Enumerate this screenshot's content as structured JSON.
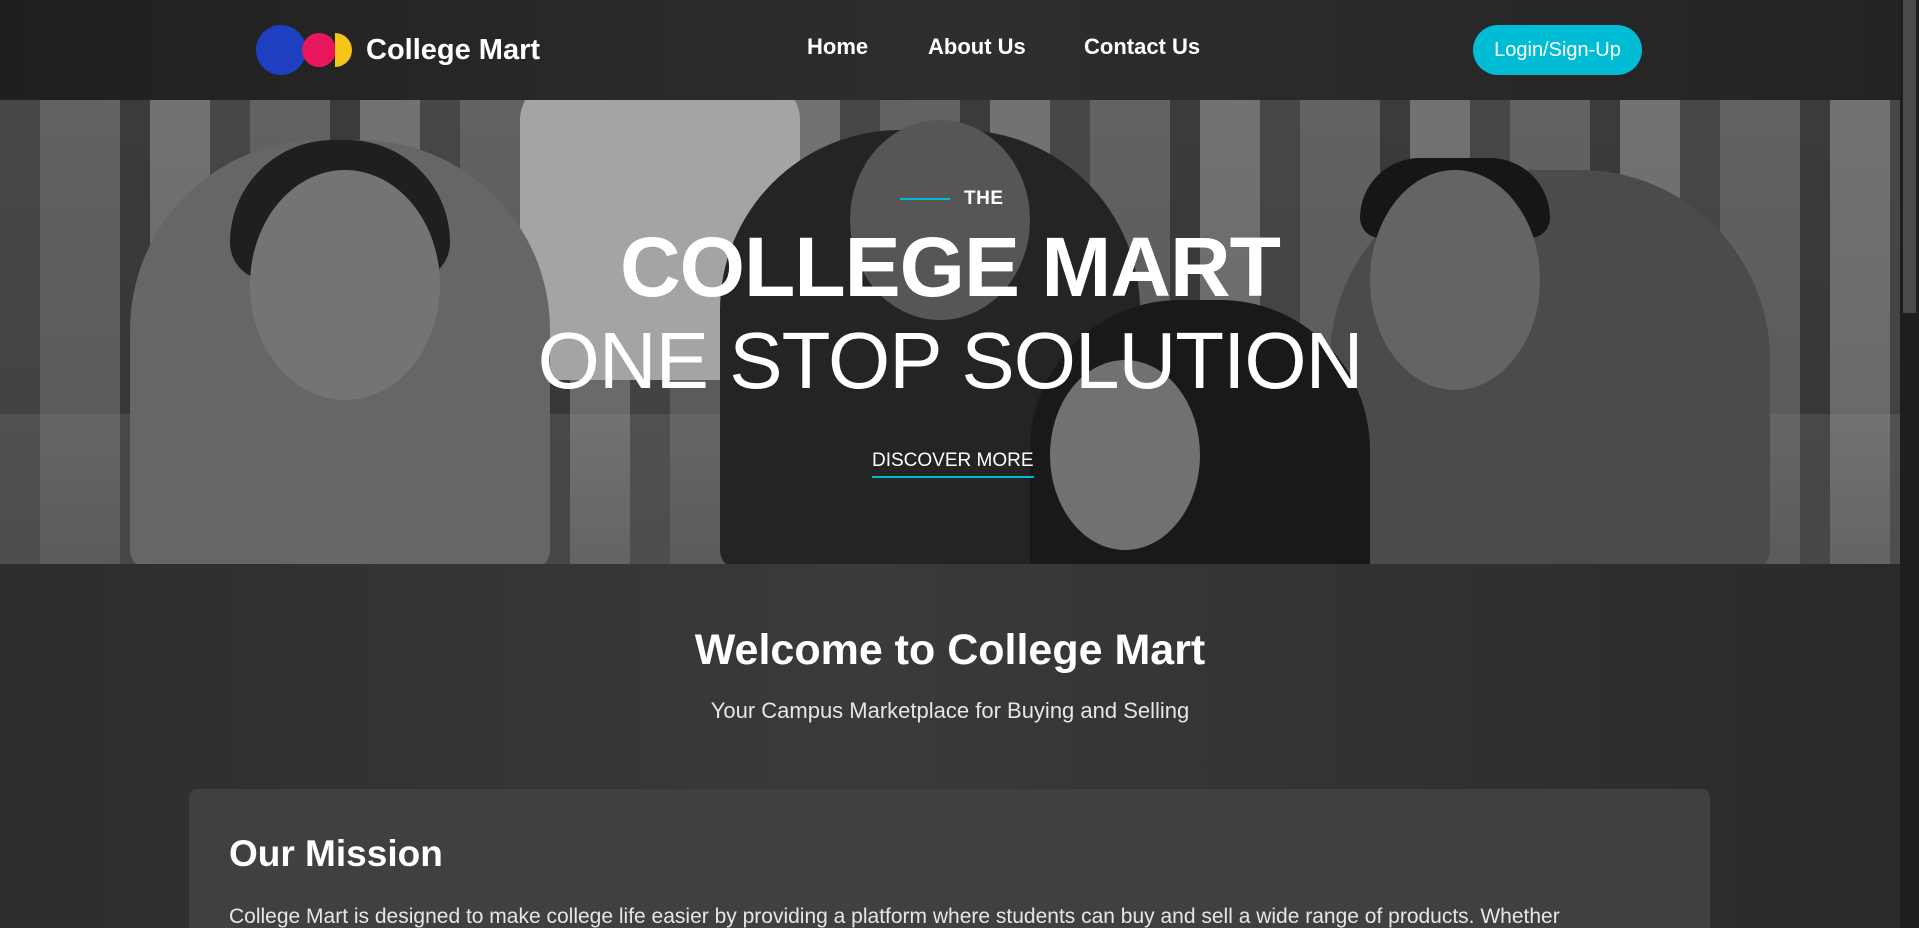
{
  "brand": {
    "name": "College Mart",
    "logo_colors": [
      "#1e3fbf",
      "#e8175d",
      "#f5c518"
    ]
  },
  "nav": {
    "home": "Home",
    "about": "About Us",
    "contact": "Contact Us",
    "login": "Login/Sign-Up"
  },
  "hero": {
    "kicker": "THE",
    "title": "COLLEGE MART",
    "subtitle": "ONE STOP SOLUTION",
    "cta": "DISCOVER MORE"
  },
  "welcome": {
    "title": "Welcome to College Mart",
    "subtitle": "Your Campus Marketplace for Buying and Selling"
  },
  "mission": {
    "title": "Our Mission",
    "text": "College Mart is designed to make college life easier by providing a platform where students can buy and sell a wide range of products. Whether"
  },
  "colors": {
    "accent": "#00bcd4",
    "background": "#2b2b2b",
    "card": "#404040"
  }
}
